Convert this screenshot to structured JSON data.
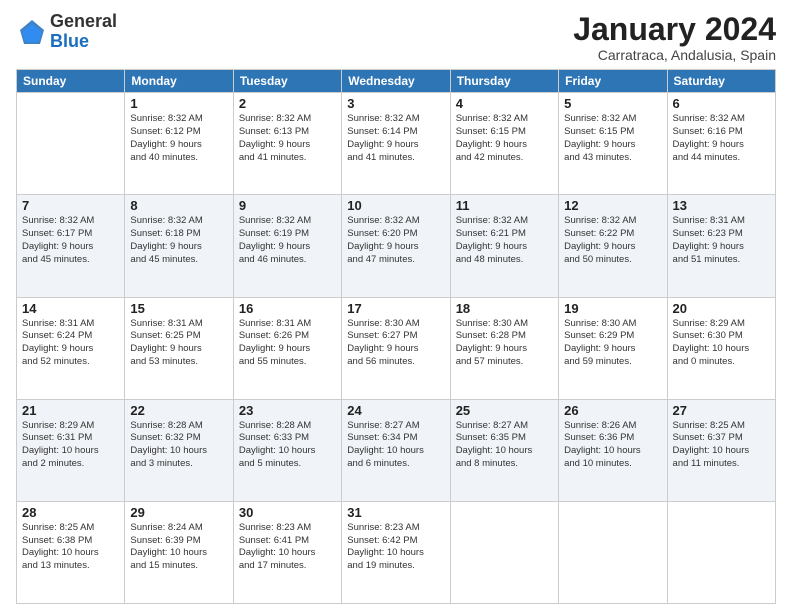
{
  "header": {
    "logo_general": "General",
    "logo_blue": "Blue",
    "month_year": "January 2024",
    "location": "Carratraca, Andalusia, Spain"
  },
  "columns": [
    "Sunday",
    "Monday",
    "Tuesday",
    "Wednesday",
    "Thursday",
    "Friday",
    "Saturday"
  ],
  "weeks": [
    {
      "days": [
        {
          "num": "",
          "info": ""
        },
        {
          "num": "1",
          "info": "Sunrise: 8:32 AM\nSunset: 6:12 PM\nDaylight: 9 hours\nand 40 minutes."
        },
        {
          "num": "2",
          "info": "Sunrise: 8:32 AM\nSunset: 6:13 PM\nDaylight: 9 hours\nand 41 minutes."
        },
        {
          "num": "3",
          "info": "Sunrise: 8:32 AM\nSunset: 6:14 PM\nDaylight: 9 hours\nand 41 minutes."
        },
        {
          "num": "4",
          "info": "Sunrise: 8:32 AM\nSunset: 6:15 PM\nDaylight: 9 hours\nand 42 minutes."
        },
        {
          "num": "5",
          "info": "Sunrise: 8:32 AM\nSunset: 6:15 PM\nDaylight: 9 hours\nand 43 minutes."
        },
        {
          "num": "6",
          "info": "Sunrise: 8:32 AM\nSunset: 6:16 PM\nDaylight: 9 hours\nand 44 minutes."
        }
      ]
    },
    {
      "days": [
        {
          "num": "7",
          "info": "Sunrise: 8:32 AM\nSunset: 6:17 PM\nDaylight: 9 hours\nand 45 minutes."
        },
        {
          "num": "8",
          "info": "Sunrise: 8:32 AM\nSunset: 6:18 PM\nDaylight: 9 hours\nand 45 minutes."
        },
        {
          "num": "9",
          "info": "Sunrise: 8:32 AM\nSunset: 6:19 PM\nDaylight: 9 hours\nand 46 minutes."
        },
        {
          "num": "10",
          "info": "Sunrise: 8:32 AM\nSunset: 6:20 PM\nDaylight: 9 hours\nand 47 minutes."
        },
        {
          "num": "11",
          "info": "Sunrise: 8:32 AM\nSunset: 6:21 PM\nDaylight: 9 hours\nand 48 minutes."
        },
        {
          "num": "12",
          "info": "Sunrise: 8:32 AM\nSunset: 6:22 PM\nDaylight: 9 hours\nand 50 minutes."
        },
        {
          "num": "13",
          "info": "Sunrise: 8:31 AM\nSunset: 6:23 PM\nDaylight: 9 hours\nand 51 minutes."
        }
      ]
    },
    {
      "days": [
        {
          "num": "14",
          "info": "Sunrise: 8:31 AM\nSunset: 6:24 PM\nDaylight: 9 hours\nand 52 minutes."
        },
        {
          "num": "15",
          "info": "Sunrise: 8:31 AM\nSunset: 6:25 PM\nDaylight: 9 hours\nand 53 minutes."
        },
        {
          "num": "16",
          "info": "Sunrise: 8:31 AM\nSunset: 6:26 PM\nDaylight: 9 hours\nand 55 minutes."
        },
        {
          "num": "17",
          "info": "Sunrise: 8:30 AM\nSunset: 6:27 PM\nDaylight: 9 hours\nand 56 minutes."
        },
        {
          "num": "18",
          "info": "Sunrise: 8:30 AM\nSunset: 6:28 PM\nDaylight: 9 hours\nand 57 minutes."
        },
        {
          "num": "19",
          "info": "Sunrise: 8:30 AM\nSunset: 6:29 PM\nDaylight: 9 hours\nand 59 minutes."
        },
        {
          "num": "20",
          "info": "Sunrise: 8:29 AM\nSunset: 6:30 PM\nDaylight: 10 hours\nand 0 minutes."
        }
      ]
    },
    {
      "days": [
        {
          "num": "21",
          "info": "Sunrise: 8:29 AM\nSunset: 6:31 PM\nDaylight: 10 hours\nand 2 minutes."
        },
        {
          "num": "22",
          "info": "Sunrise: 8:28 AM\nSunset: 6:32 PM\nDaylight: 10 hours\nand 3 minutes."
        },
        {
          "num": "23",
          "info": "Sunrise: 8:28 AM\nSunset: 6:33 PM\nDaylight: 10 hours\nand 5 minutes."
        },
        {
          "num": "24",
          "info": "Sunrise: 8:27 AM\nSunset: 6:34 PM\nDaylight: 10 hours\nand 6 minutes."
        },
        {
          "num": "25",
          "info": "Sunrise: 8:27 AM\nSunset: 6:35 PM\nDaylight: 10 hours\nand 8 minutes."
        },
        {
          "num": "26",
          "info": "Sunrise: 8:26 AM\nSunset: 6:36 PM\nDaylight: 10 hours\nand 10 minutes."
        },
        {
          "num": "27",
          "info": "Sunrise: 8:25 AM\nSunset: 6:37 PM\nDaylight: 10 hours\nand 11 minutes."
        }
      ]
    },
    {
      "days": [
        {
          "num": "28",
          "info": "Sunrise: 8:25 AM\nSunset: 6:38 PM\nDaylight: 10 hours\nand 13 minutes."
        },
        {
          "num": "29",
          "info": "Sunrise: 8:24 AM\nSunset: 6:39 PM\nDaylight: 10 hours\nand 15 minutes."
        },
        {
          "num": "30",
          "info": "Sunrise: 8:23 AM\nSunset: 6:41 PM\nDaylight: 10 hours\nand 17 minutes."
        },
        {
          "num": "31",
          "info": "Sunrise: 8:23 AM\nSunset: 6:42 PM\nDaylight: 10 hours\nand 19 minutes."
        },
        {
          "num": "",
          "info": ""
        },
        {
          "num": "",
          "info": ""
        },
        {
          "num": "",
          "info": ""
        }
      ]
    }
  ]
}
